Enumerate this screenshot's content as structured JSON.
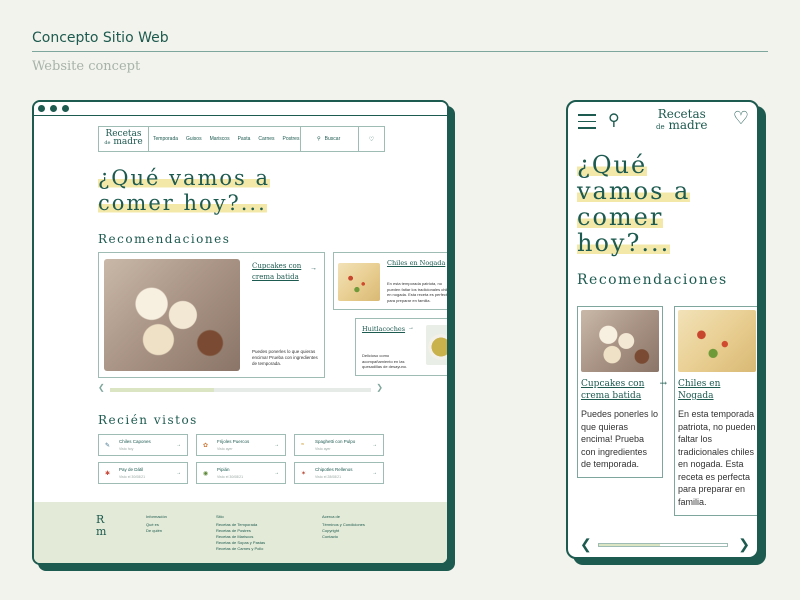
{
  "header": {
    "title": "Concepto Sitio Web",
    "subtitle": "Website concept"
  },
  "desktop": {
    "logo": {
      "line1": "Recetas",
      "line2_small": "de",
      "line2": "madre"
    },
    "nav": [
      "Temporada",
      "Guisos",
      "Mariscos",
      "Pasta",
      "Carnes",
      "Postres"
    ],
    "search_label": "Buscar",
    "hero": {
      "line1": "¿Qué vamos a",
      "line2": "comer hoy?..."
    },
    "recommendations_title": "Recomendaciones",
    "cards": [
      {
        "title": "Cupcakes con crema batida",
        "text": "Puedes ponerles lo que quieras encima! Prueba con ingredientes de temporada."
      },
      {
        "title": "Chiles en Nogada",
        "text": "En esta temporada patriota, no pueden faltar los tradicionales chiles en nogada. Esta receta es perfecta para preparar en familia."
      },
      {
        "title": "Huitlacoches",
        "text": "Delicioso como acompañamiento en las quesadillas de desayuno."
      }
    ],
    "scroll_progress": 0.4,
    "recent_title": "Recién vistos",
    "recent": [
      {
        "name": "Chiles Capones",
        "meta": "Visto hoy"
      },
      {
        "name": "Frijoles Puercos",
        "meta": "Visto ayer"
      },
      {
        "name": "Spaghetti con Pulpo",
        "meta": "Visto ayer"
      },
      {
        "name": "Pay de Dátil",
        "meta": "Visto el 30/08/21"
      },
      {
        "name": "Pipián",
        "meta": "Visto el 30/08/21"
      },
      {
        "name": "Chipotles Rellenos",
        "meta": "Visto el 28/08/21"
      }
    ],
    "footer": {
      "logo_top": "R",
      "logo_bottom": "m",
      "columns": [
        {
          "heading": "Información",
          "items": [
            "Qué es",
            "De quién"
          ]
        },
        {
          "heading": "Sitio",
          "items": [
            "Recetas de Temporada",
            "Recetas de Postres",
            "Recetas de Mariscos",
            "Recetas de Sopas y Pastas",
            "Recetas de Carnes y Pollo"
          ]
        },
        {
          "heading": "Acerca de",
          "items": [
            "Términos y Condiciones",
            "Copyright",
            "Contacto"
          ]
        }
      ]
    }
  },
  "mobile": {
    "logo": {
      "line1": "Recetas",
      "line2_small": "de",
      "line2": "madre"
    },
    "hero": {
      "line1": "¿Qué",
      "line2": "vamos a",
      "line3": "comer",
      "line4": "hoy?..."
    },
    "recommendations_title": "Recomendaciones",
    "cards": [
      {
        "title": "Cupcakes con crema batida",
        "text": "Puedes ponerles lo que quieras encima! Prueba con ingredientes de temporada."
      },
      {
        "title": "Chiles en Nogada",
        "text": "En esta temporada patriota, no pueden faltar los tradicionales chiles en nogada. Esta receta es perfecta para preparar en familia."
      }
    ],
    "scroll_progress": 0.48
  },
  "colors": {
    "primary": "#1d5a4f",
    "highlight": "#f3e8a8",
    "footer_bg": "#e3ead7",
    "page_bg": "#f2f3ec"
  },
  "icons": [
    "search-icon",
    "heart-icon",
    "menu-icon",
    "arrow-right-icon",
    "chevron-left-icon",
    "chevron-right-icon"
  ]
}
